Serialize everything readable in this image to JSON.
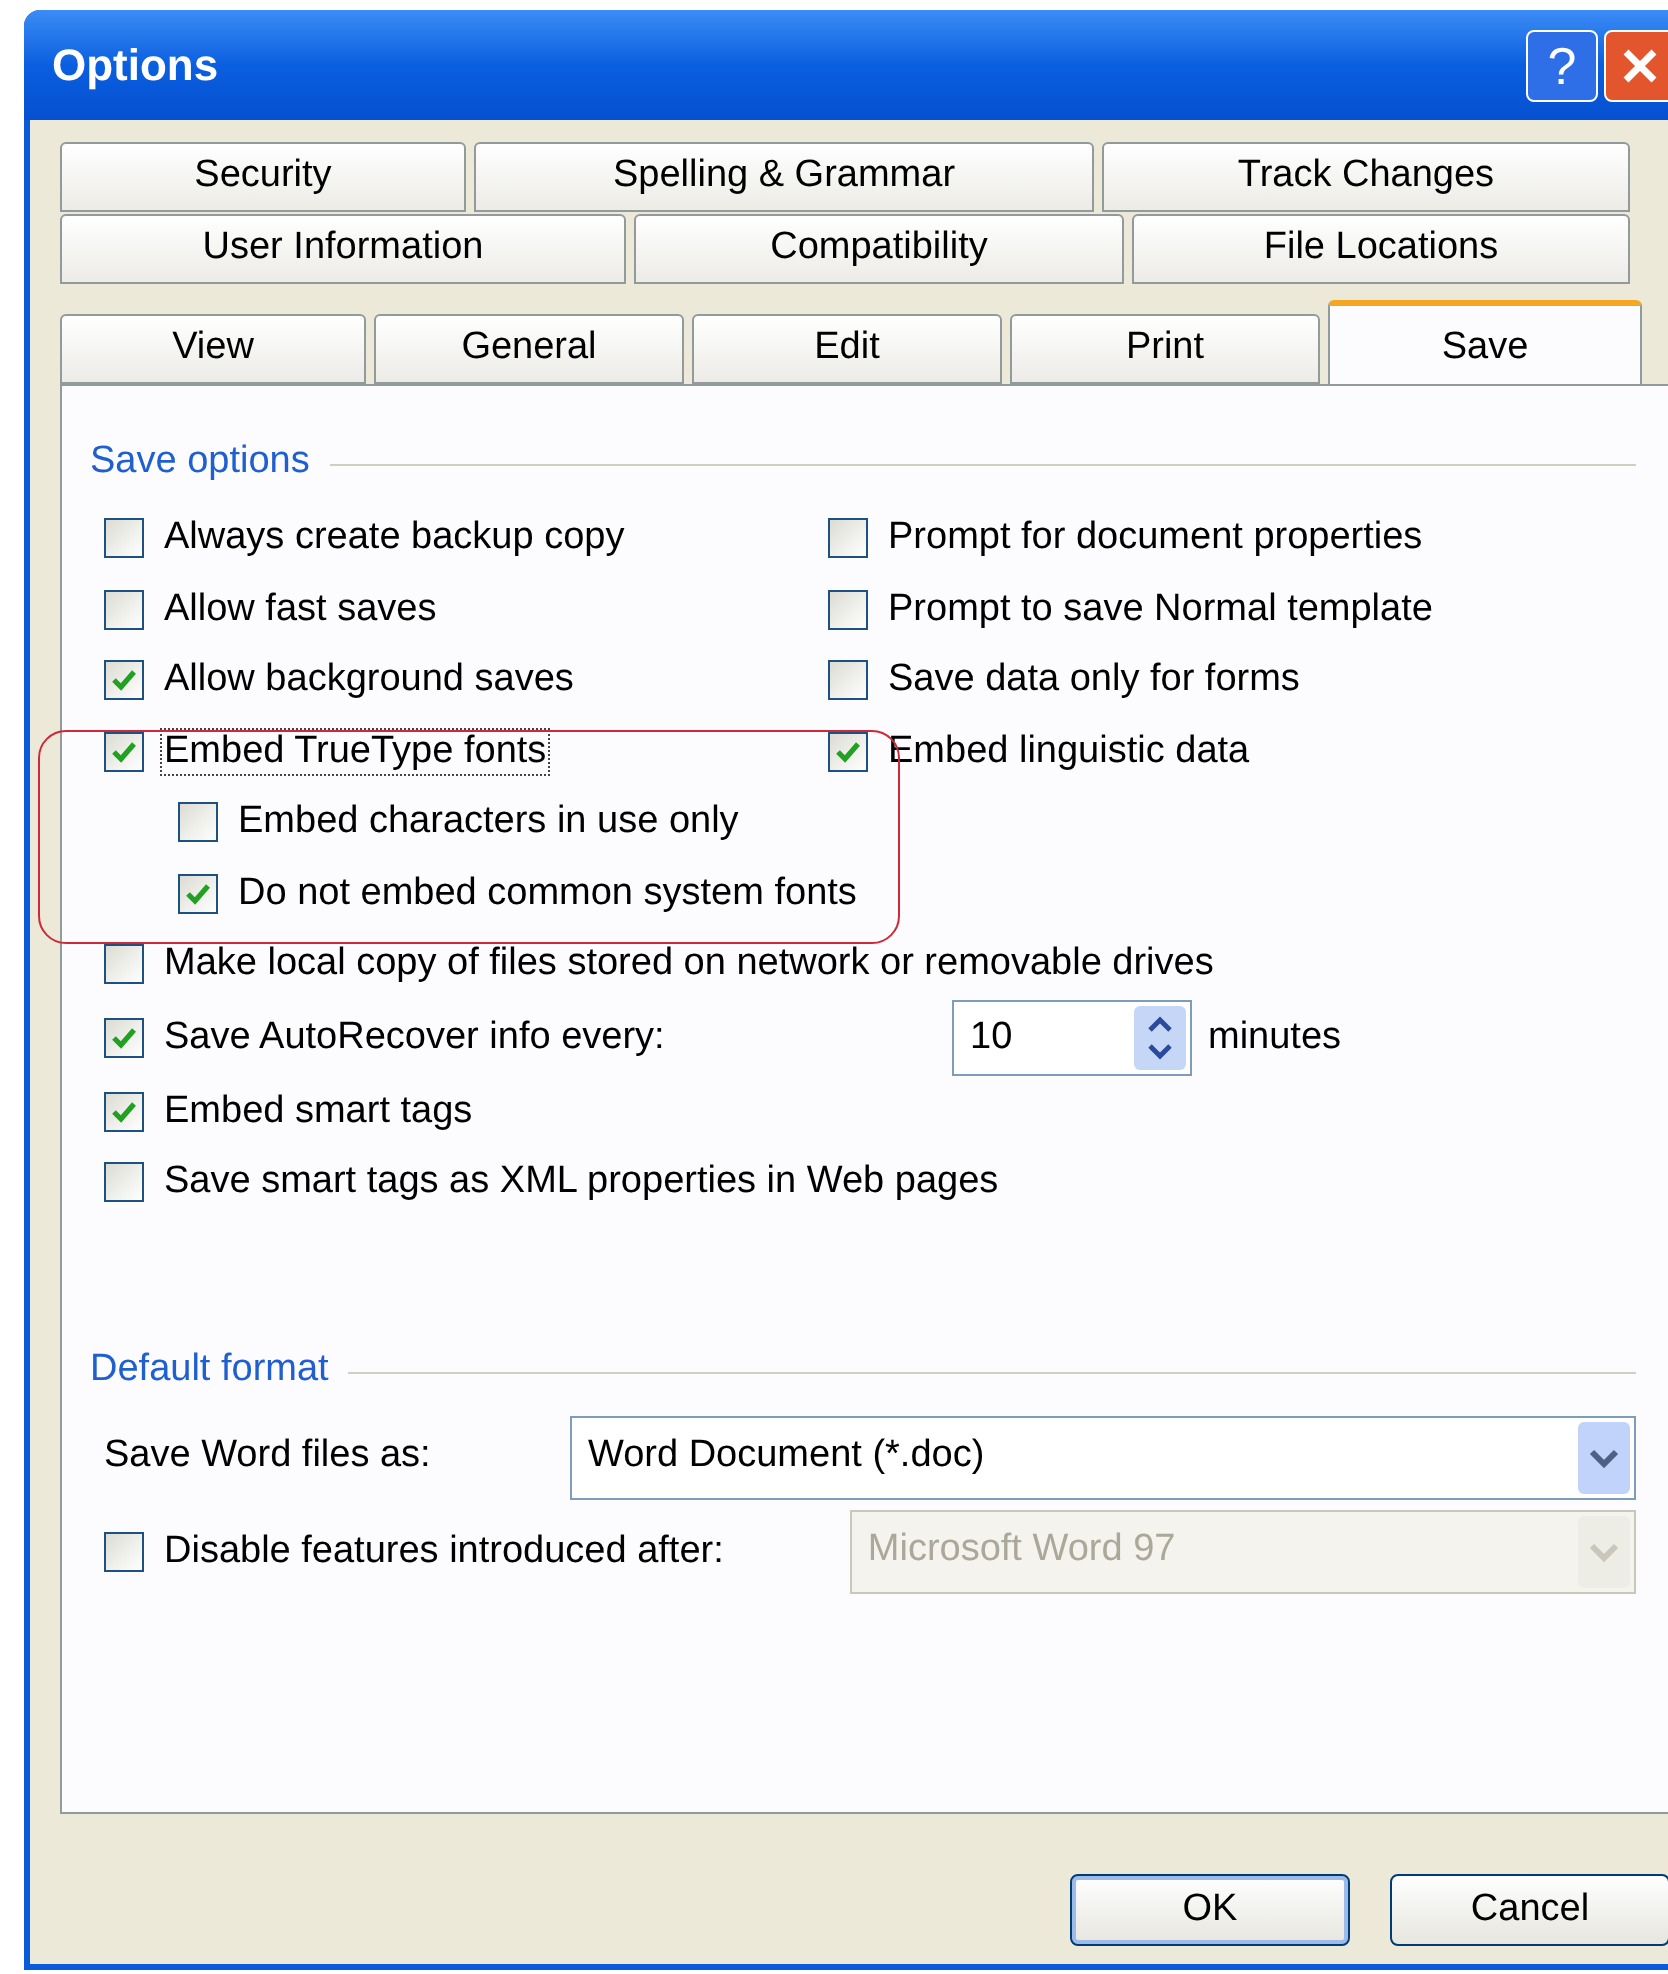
{
  "window": {
    "title": "Options",
    "help_button": "?"
  },
  "tabs": [
    [
      {
        "label": "Security",
        "selected": false
      },
      {
        "label": "Spelling & Grammar",
        "selected": false
      },
      {
        "label": "Track Changes",
        "selected": false
      }
    ],
    [
      {
        "label": "User Information",
        "selected": false
      },
      {
        "label": "Compatibility",
        "selected": false
      },
      {
        "label": "File Locations",
        "selected": false
      }
    ],
    [
      {
        "label": "View",
        "selected": false
      },
      {
        "label": "General",
        "selected": false
      },
      {
        "label": "Edit",
        "selected": false
      },
      {
        "label": "Print",
        "selected": false
      },
      {
        "label": "Save",
        "selected": true
      }
    ]
  ],
  "save_options": {
    "title": "Save options",
    "columns": [
      [
        {
          "label": "Always create backup copy",
          "checked": false
        },
        {
          "label": "Allow fast saves",
          "checked": false
        },
        {
          "label": "Allow background saves",
          "checked": true
        },
        {
          "label": "Embed TrueType fonts",
          "checked": true,
          "focused": true,
          "children": [
            {
              "label": "Embed characters in use only",
              "checked": false
            },
            {
              "label": "Do not embed common system fonts",
              "checked": true
            }
          ]
        }
      ],
      [
        {
          "label": "Prompt for document properties",
          "checked": false
        },
        {
          "label": "Prompt to save Normal template",
          "checked": false
        },
        {
          "label": "Save data only for forms",
          "checked": false
        },
        {
          "label": "Embed linguistic data",
          "checked": true
        }
      ]
    ],
    "items": [
      {
        "kind": "check",
        "label": "Make local copy of files stored on network or removable drives",
        "checked": false
      },
      {
        "kind": "spin",
        "label": "Save AutoRecover info every:",
        "checked": true,
        "value": "10",
        "unit": "minutes"
      },
      {
        "kind": "check",
        "label": "Embed smart tags",
        "checked": true
      },
      {
        "kind": "check",
        "label": "Save smart tags as XML properties in Web pages",
        "checked": false
      }
    ]
  },
  "default_format": {
    "title": "Default format",
    "save_as": {
      "label": "Save Word files as:",
      "value": "Word Document (*.doc)"
    },
    "disable_features": {
      "label": "Disable features introduced after:",
      "checked": false,
      "value": "Microsoft Word 97",
      "disabled": true
    }
  },
  "buttons": [
    {
      "label": "OK",
      "default": true
    },
    {
      "label": "Cancel",
      "default": false
    }
  ]
}
